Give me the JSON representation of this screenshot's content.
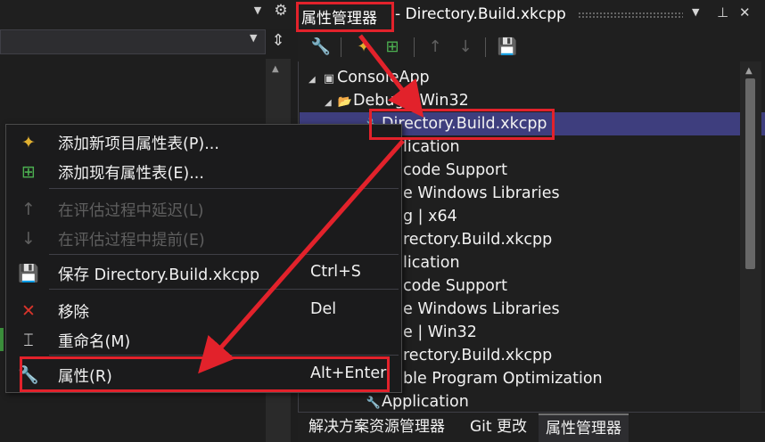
{
  "left_pane": {
    "top_arrow": "▼",
    "gear": "⚙",
    "dropdown_arrow": "▼",
    "split": "⇕",
    "scroll_up": "▲"
  },
  "property_manager": {
    "title_tab": "属性管理器",
    "title_file": " - Directory.Build.xkcpp",
    "window_buttons": {
      "dropdown": "▼",
      "pin": "⊥",
      "close": "✕"
    },
    "toolbar": {
      "properties": "🔧",
      "add_new_sheet": "✦",
      "add_existing_sheet": "⊞",
      "move_up": "↑",
      "move_down": "↓",
      "save": "💾"
    },
    "tree": [
      {
        "twist": "◢",
        "icon": "▣",
        "text": "ConsoleApp",
        "selected": false
      },
      {
        "twist": "◢",
        "icon": "📂",
        "text": "Debug | Win32",
        "selected": false
      },
      {
        "twist": "",
        "icon": "🔧",
        "text": "Directory.Build.xkcpp",
        "selected": true
      },
      {
        "twist": "",
        "icon": "",
        "text": "lication",
        "selected": false
      },
      {
        "twist": "",
        "icon": "",
        "text": "code Support",
        "selected": false
      },
      {
        "twist": "",
        "icon": "",
        "text": "e Windows Libraries",
        "selected": false
      },
      {
        "twist": "",
        "icon": "",
        "text": "g | x64",
        "selected": false
      },
      {
        "twist": "",
        "icon": "",
        "text": "rectory.Build.xkcpp",
        "selected": false
      },
      {
        "twist": "",
        "icon": "",
        "text": "lication",
        "selected": false
      },
      {
        "twist": "",
        "icon": "",
        "text": "code Support",
        "selected": false
      },
      {
        "twist": "",
        "icon": "",
        "text": "e Windows Libraries",
        "selected": false
      },
      {
        "twist": "",
        "icon": "",
        "text": "e | Win32",
        "selected": false
      },
      {
        "twist": "",
        "icon": "",
        "text": "rectory.Build.xkcpp",
        "selected": false
      },
      {
        "twist": "",
        "icon": "",
        "text": "ble Program Optimization",
        "selected": false
      },
      {
        "twist": "",
        "icon": "🔧",
        "text": "Application",
        "selected": false
      }
    ],
    "bottom_tabs": [
      "解决方案资源管理器",
      "Git 更改",
      "属性管理器"
    ]
  },
  "context_menu": {
    "items": [
      {
        "icon": "✦",
        "label": "添加新项目属性表(P)...",
        "shortcut": "",
        "disabled": false,
        "icon_color": "#e0b030"
      },
      {
        "icon": "⊞",
        "label": "添加现有属性表(E)...",
        "shortcut": "",
        "disabled": false,
        "icon_color": "#4caf50"
      },
      {
        "icon": "↑",
        "label": "在评估过程中延迟(L)",
        "shortcut": "",
        "disabled": true,
        "icon_color": "#5f5f5f"
      },
      {
        "icon": "↓",
        "label": "在评估过程中提前(E)",
        "shortcut": "",
        "disabled": true,
        "icon_color": "#5f5f5f"
      },
      {
        "icon": "💾",
        "label": "保存 Directory.Build.xkcpp",
        "shortcut": "Ctrl+S",
        "disabled": false,
        "icon_color": "#4aa3df"
      },
      {
        "icon": "✕",
        "label": "移除",
        "shortcut": "Del",
        "disabled": false,
        "icon_color": "#d9342b"
      },
      {
        "icon": "⌶",
        "label": "重命名(M)",
        "shortcut": "",
        "disabled": false,
        "icon_color": "#cfcfcf"
      },
      {
        "icon": "🔧",
        "label": "属性(R)",
        "shortcut": "Alt+Enter",
        "disabled": false,
        "icon_color": "#cfcfcf"
      }
    ]
  },
  "colors": {
    "annotation_red": "#e2222b",
    "selection": "#3e3e7e",
    "save_blue": "#4aa3df",
    "add_green": "#4caf50"
  }
}
